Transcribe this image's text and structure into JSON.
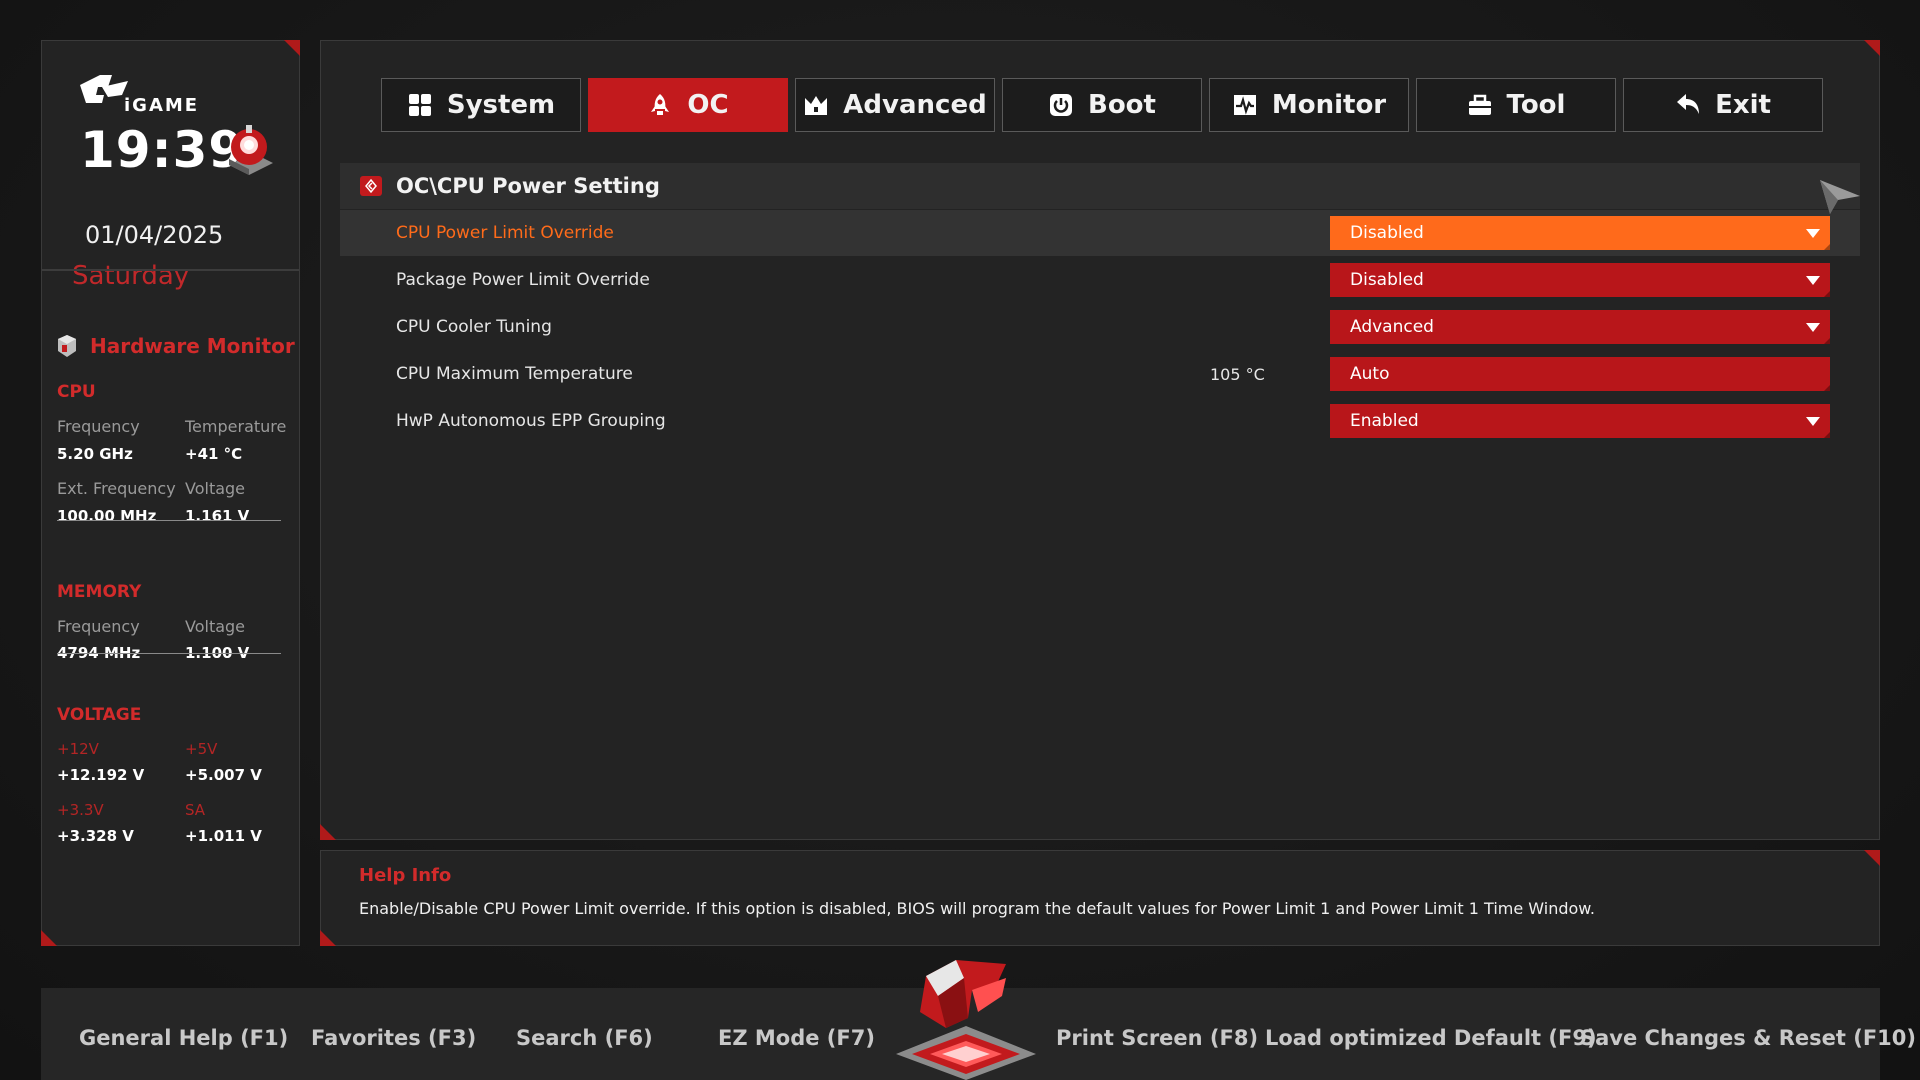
{
  "clock": {
    "time": "19:39",
    "date": "01/04/2025",
    "weekday": "Saturday"
  },
  "hardware_monitor": {
    "title": "Hardware Monitor",
    "cpu": {
      "section": "CPU",
      "frequency_label": "Frequency",
      "frequency_value": "5.20 GHz",
      "temperature_label": "Temperature",
      "temperature_value": "+41 °C",
      "ext_frequency_label": "Ext. Frequency",
      "ext_frequency_value": "100.00 MHz",
      "voltage_label": "Voltage",
      "voltage_value": "1.161 V"
    },
    "memory": {
      "section": "MEMORY",
      "frequency_label": "Frequency",
      "frequency_value": "4794 MHz",
      "voltage_label": "Voltage",
      "voltage_value": "1.100 V"
    },
    "voltage": {
      "section": "VOLTAGE",
      "v12_label": "+12V",
      "v12_value": "+12.192 V",
      "v5_label": "+5V",
      "v5_value": "+5.007 V",
      "v33_label": "+3.3V",
      "v33_value": "+3.328 V",
      "sa_label": "SA",
      "sa_value": "+1.011 V"
    }
  },
  "tabs": [
    {
      "label": "System",
      "icon": "grid-icon",
      "active": false
    },
    {
      "label": "OC",
      "icon": "rocket-icon",
      "active": true
    },
    {
      "label": "Advanced",
      "icon": "crown-icon",
      "active": false
    },
    {
      "label": "Boot",
      "icon": "power-icon",
      "active": false
    },
    {
      "label": "Monitor",
      "icon": "pulse-icon",
      "active": false
    },
    {
      "label": "Tool",
      "icon": "toolbox-icon",
      "active": false
    },
    {
      "label": "Exit",
      "icon": "back-arrow-icon",
      "active": false
    }
  ],
  "breadcrumb": "OC\\CPU Power Setting",
  "settings": [
    {
      "label": "CPU Power Limit Override",
      "value": "Disabled",
      "extra": "",
      "has_dropdown": true,
      "selected": true
    },
    {
      "label": "Package Power Limit Override",
      "value": "Disabled",
      "extra": "",
      "has_dropdown": true,
      "selected": false
    },
    {
      "label": "CPU Cooler Tuning",
      "value": "Advanced",
      "extra": "",
      "has_dropdown": true,
      "selected": false
    },
    {
      "label": "CPU Maximum Temperature",
      "value": "Auto",
      "extra": "105 °C",
      "has_dropdown": false,
      "selected": false
    },
    {
      "label": "HwP Autonomous EPP Grouping",
      "value": "Enabled",
      "extra": "",
      "has_dropdown": true,
      "selected": false
    }
  ],
  "help": {
    "title": "Help Info",
    "text": "Enable/Disable CPU Power Limit override. If this option is disabled, BIOS will program the default values for Power Limit 1 and Power Limit 1 Time Window."
  },
  "footer": {
    "general_help": "General Help (F1)",
    "favorites": "Favorites (F3)",
    "search": "Search (F6)",
    "ez_mode": "EZ Mode (F7)",
    "print_screen": "Print Screen (F8)",
    "load_default": "Load optimized Default (F9)",
    "save_reset": "Save Changes & Reset (F10)"
  },
  "colors": {
    "accent": "#c21a1d",
    "selected": "#ff6a1b",
    "panel": "#232323",
    "background": "#181818"
  }
}
